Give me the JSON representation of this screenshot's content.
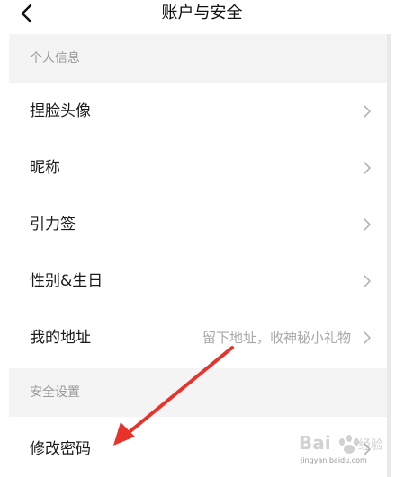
{
  "header": {
    "title": "账户与安全"
  },
  "sections": {
    "personal": {
      "title": "个人信息"
    },
    "security": {
      "title": "安全设置"
    }
  },
  "rows": {
    "avatar": {
      "label": "捏脸头像"
    },
    "nickname": {
      "label": "昵称"
    },
    "signature": {
      "label": "引力签"
    },
    "gender_birthday": {
      "label": "性别&生日"
    },
    "address": {
      "label": "我的地址",
      "hint": "留下地址，收神秘小礼物"
    },
    "password": {
      "label": "修改密码"
    }
  },
  "watermark": {
    "text": "Bai 经验",
    "url": "jingyan.baidu.com"
  },
  "colors": {
    "annotation_arrow": "#e8322c",
    "section_bg": "#f4f4f4"
  }
}
